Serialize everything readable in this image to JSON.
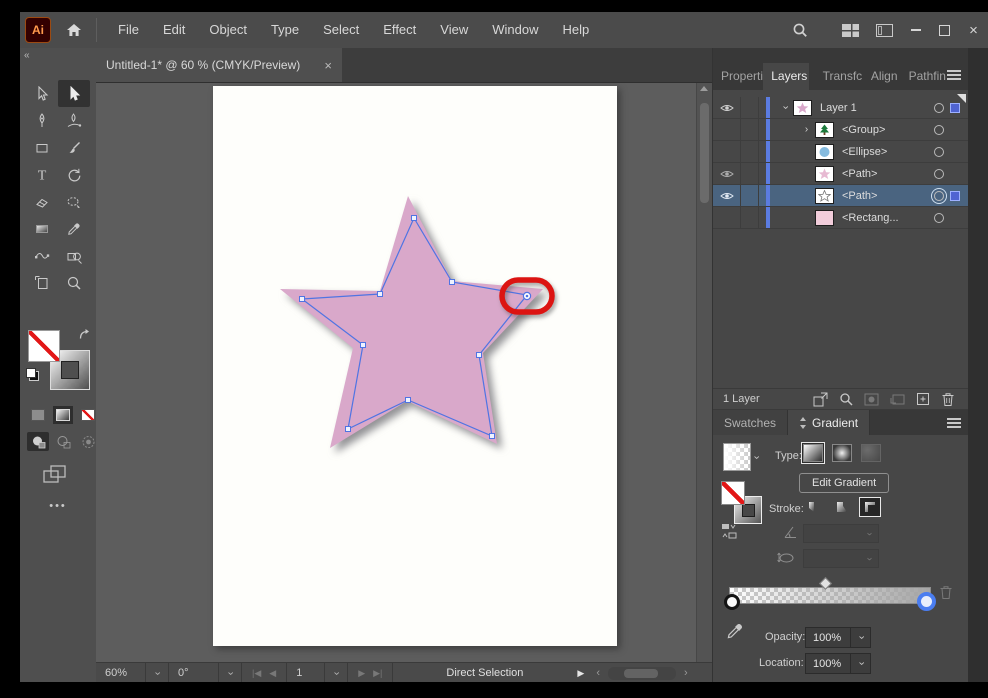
{
  "colors": {
    "accent_blue": "#5b7ce1",
    "path_blue": "#4f74e3",
    "star_pink": "#d9a8ca",
    "annotation_red": "#dc1412",
    "layer_selected_row": "#4a6480"
  },
  "titlebar": {
    "app_logo": "Ai",
    "menus": [
      "File",
      "Edit",
      "Object",
      "Type",
      "Select",
      "Effect",
      "View",
      "Window",
      "Help"
    ],
    "close_label": "×"
  },
  "doc_tab": {
    "title": "Untitled-1* @ 60 % (CMYK/Preview)",
    "close": "×"
  },
  "toolbar": {
    "collapse": "«",
    "tools": [
      "selection",
      "direct-selection",
      "pen",
      "curvature",
      "rectangle",
      "paintbrush",
      "type",
      "rotate",
      "eraser",
      "shaper",
      "gradient",
      "eyedropper",
      "width",
      "shape-builder",
      "artboard",
      "zoom"
    ],
    "active_tool": "direct-selection"
  },
  "layers_panel": {
    "tabs": [
      {
        "label": "Properti"
      },
      {
        "label": "Layers"
      },
      {
        "label": "Transfc"
      },
      {
        "label": "Align"
      },
      {
        "label": "Pathfin"
      }
    ],
    "active_tab": "Layers",
    "rows": [
      {
        "label": "Layer 1",
        "visible": true,
        "expander": "down",
        "thumb": "pink-star"
      },
      {
        "label": "<Group>",
        "visible": false,
        "expander": "right",
        "thumb": "green-tree"
      },
      {
        "label": "<Ellipse>",
        "visible": false,
        "thumb": "blue-ellipse"
      },
      {
        "label": "<Path>",
        "visible": true,
        "thumb": "pink-star-solid"
      },
      {
        "label": "<Path>",
        "visible": true,
        "thumb": "star-outline",
        "selected": true,
        "targeted": true
      },
      {
        "label": "<Rectang...",
        "visible": false,
        "thumb": "pink-rect"
      }
    ],
    "footer": {
      "count": "1 Layer"
    }
  },
  "gradient_panel": {
    "tabs": [
      {
        "label": "Swatches"
      },
      {
        "label": "Gradient"
      }
    ],
    "active_tab": "Gradient",
    "type_label": "Type:",
    "edit_gradient_label": "Edit Gradient",
    "stroke_label": "Stroke:",
    "opacity_label": "Opacity:",
    "opacity_value": "100%",
    "location_label": "Location:",
    "location_value": "100%"
  },
  "status_bar": {
    "zoom": "60%",
    "angle": "0°",
    "artboard_number": "1",
    "tool": "Direct Selection"
  }
}
